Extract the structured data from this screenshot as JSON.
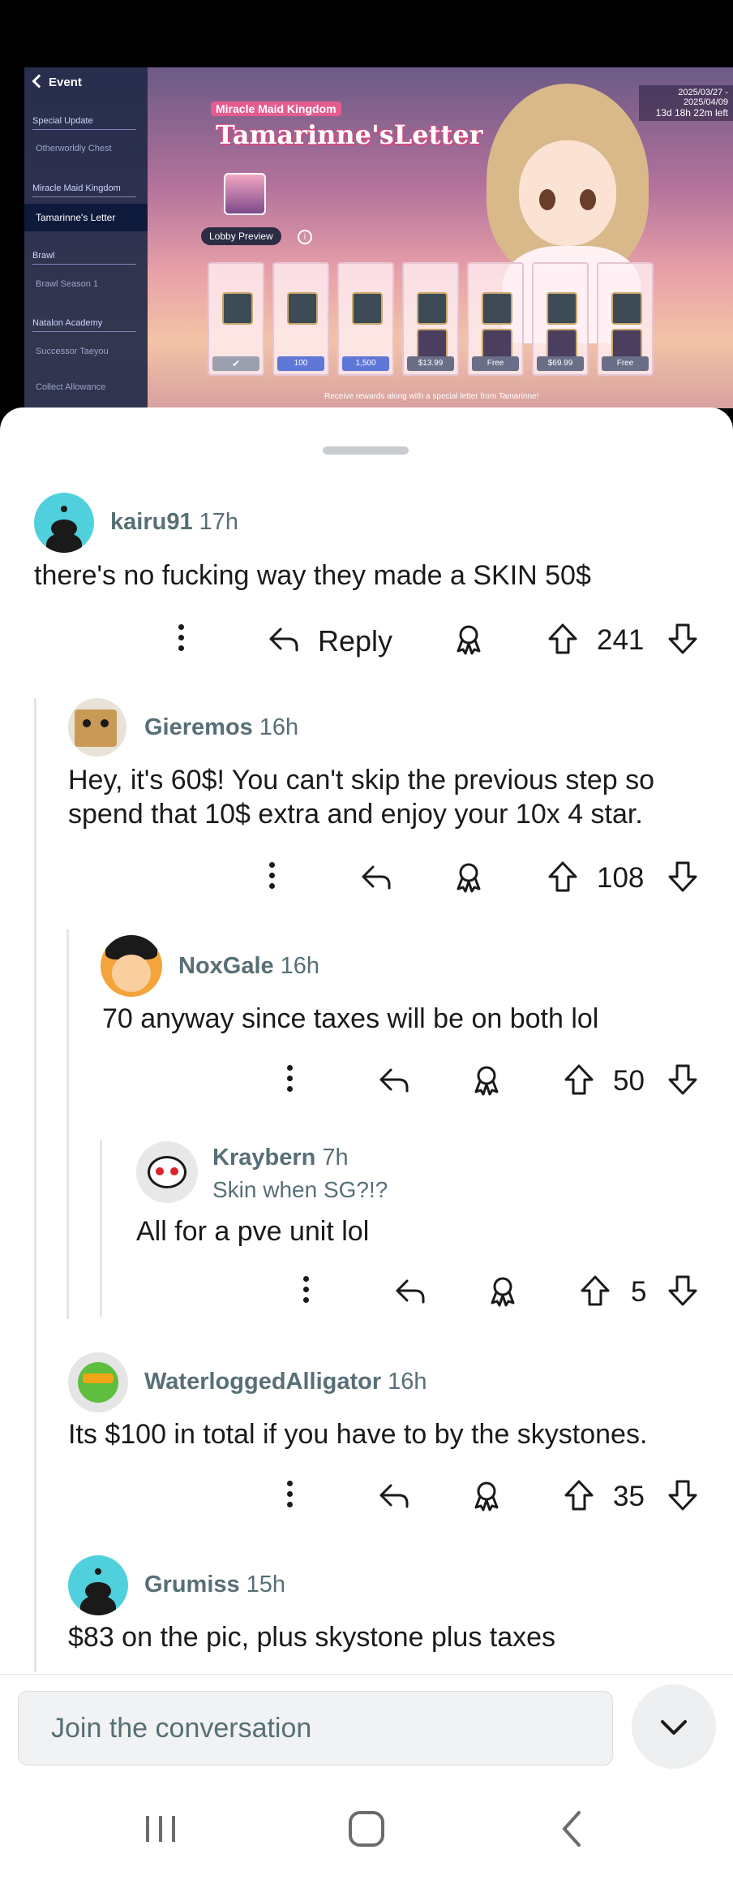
{
  "game": {
    "back_label": "Event",
    "sections": [
      {
        "title": "Special Update",
        "items": [
          "Otherworldly Chest"
        ]
      },
      {
        "title": "Miracle Maid Kingdom",
        "items": [
          "Tamarinne's Letter"
        ]
      },
      {
        "title": "Brawl",
        "items": [
          "Brawl Season 1"
        ]
      },
      {
        "title": "Natalon Academy",
        "items": [
          "Successor Taeyou",
          "Collect Allowance"
        ]
      }
    ],
    "event_small": "Miracle Maid Kingdom",
    "event_title": "Tamarinne'sLetter",
    "date_range": "2025/03/27 - 2025/04/09",
    "time_left": "13d 18h 22m left",
    "lobby_preview": "Lobby Preview",
    "prices": [
      "✔",
      "100",
      "1,500",
      "$13.99",
      "Free",
      "$69.99",
      "Free"
    ],
    "caption": "Receive rewards along with a special letter from Tamarinne!"
  },
  "comments": [
    {
      "user": "kairu91",
      "time": "17h",
      "text": "there's no fucking way they made a SKIN 50$",
      "reply_label": "Reply",
      "score": "241"
    },
    {
      "user": "Gieremos",
      "time": "16h",
      "text_lines": [
        "Hey, it's 60$! You can't skip the previous step so",
        "spend that 10$ extra and enjoy your 10x 4 star."
      ],
      "score": "108"
    },
    {
      "user": "NoxGale",
      "time": "16h",
      "text": "70 anyway since taxes will be on both lol",
      "score": "50"
    },
    {
      "user": "Kraybern",
      "time": "7h",
      "flair": "Skin when SG?!?",
      "text": "All for a pve unit lol",
      "score": "5"
    },
    {
      "user": "WaterloggedAlligator",
      "time": "16h",
      "text": "Its $100 in total if you have to by the skystones.",
      "score": "35"
    },
    {
      "user": "Grumiss",
      "time": "15h",
      "text": "$83 on the pic, plus skystone plus taxes"
    }
  ],
  "composer": {
    "placeholder": "Join the conversation"
  },
  "colors": {
    "snoo_bg": "#4fd0dc",
    "meta_text": "#576f76"
  }
}
